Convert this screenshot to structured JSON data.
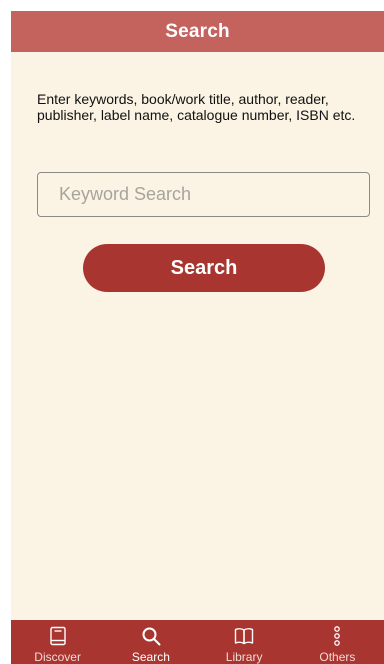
{
  "header": {
    "title": "Search"
  },
  "instructions": "Enter keywords, book/work title, author, reader, publisher, label name, catalogue number, ISBN etc.",
  "search": {
    "placeholder": "Keyword Search",
    "value": "",
    "button_label": "Search"
  },
  "tabbar": {
    "items": [
      {
        "label": "Discover",
        "icon": "book-icon"
      },
      {
        "label": "Search",
        "icon": "search-icon"
      },
      {
        "label": "Library",
        "icon": "open-book-icon"
      },
      {
        "label": "Others",
        "icon": "more-vertical-icon"
      }
    ],
    "active": "Search"
  },
  "colors": {
    "header_bg": "#c4625e",
    "background": "#fbf4e4",
    "accent": "#a8352f",
    "tab_text": "#ffffff"
  }
}
